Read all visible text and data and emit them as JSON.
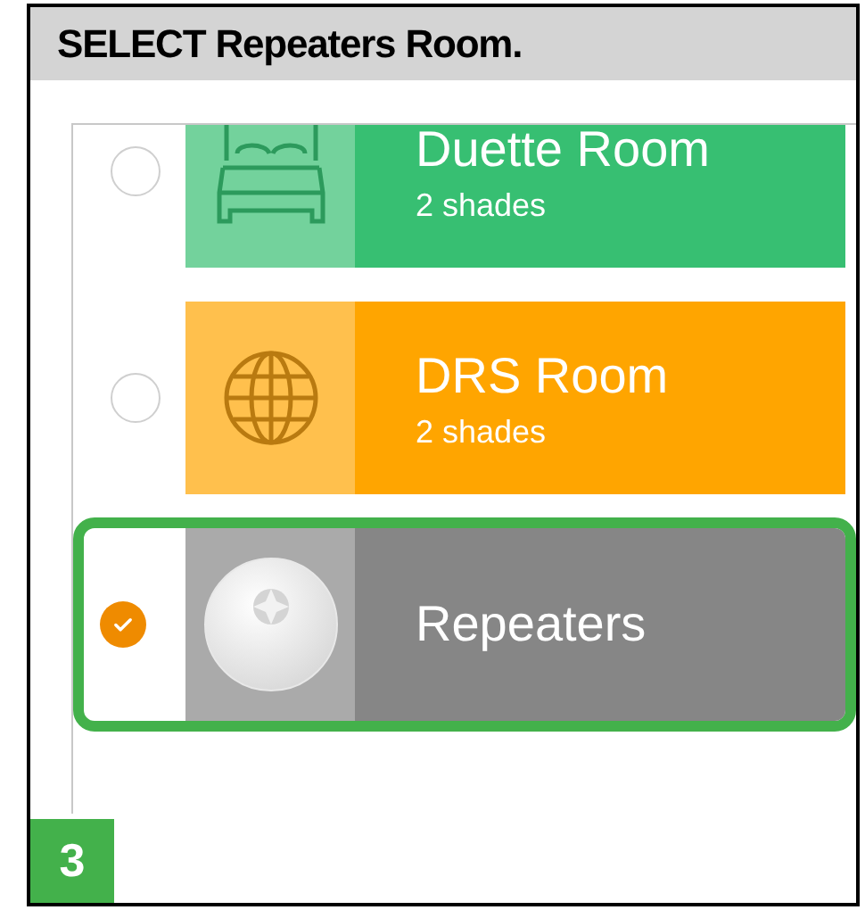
{
  "instruction": "SELECT Repeaters Room.",
  "rooms": [
    {
      "name": "Duette Room",
      "subtitle": "2 shades",
      "kind": "bed",
      "color": "#37bf72",
      "selected": false,
      "highlighted": false
    },
    {
      "name": "DRS Room",
      "subtitle": "2 shades",
      "kind": "globe",
      "color": "#ffa500",
      "selected": false,
      "highlighted": false
    },
    {
      "name": "Repeaters",
      "kind": "device",
      "color": "#868686",
      "selected": true,
      "highlighted": true
    }
  ],
  "step": "3"
}
